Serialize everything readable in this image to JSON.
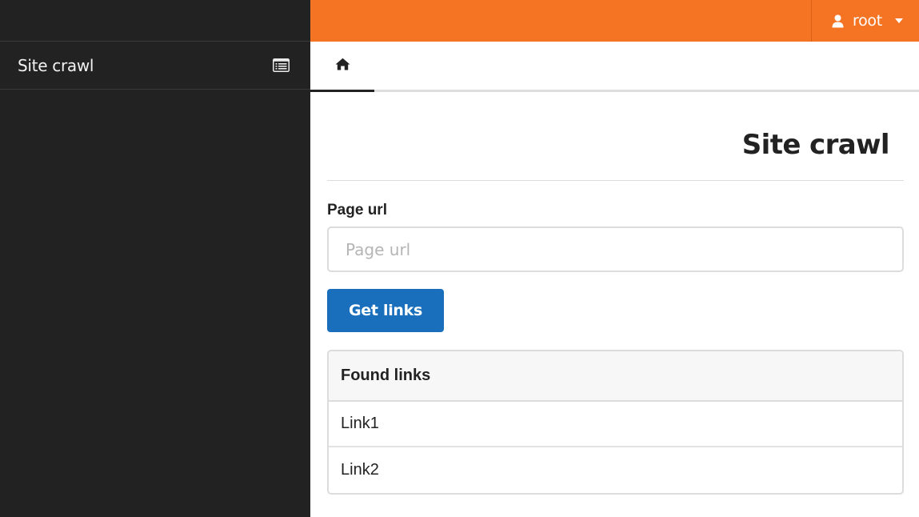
{
  "sidebar": {
    "items": [
      {
        "label": "Site crawl",
        "icon": "list-alt-icon"
      }
    ]
  },
  "header": {
    "user": {
      "name": "root",
      "icon": "user-icon"
    },
    "accent_color": "#f47424"
  },
  "tabs": {
    "home_icon": "home-icon"
  },
  "main": {
    "title": "Site crawl",
    "url_field": {
      "label": "Page url",
      "placeholder": "Page url",
      "value": ""
    },
    "submit_label": "Get links",
    "results": {
      "heading": "Found links",
      "links": [
        "Link1",
        "Link2"
      ]
    }
  },
  "colors": {
    "sidebar_bg": "#222222",
    "primary_button": "#1a6fbd"
  }
}
